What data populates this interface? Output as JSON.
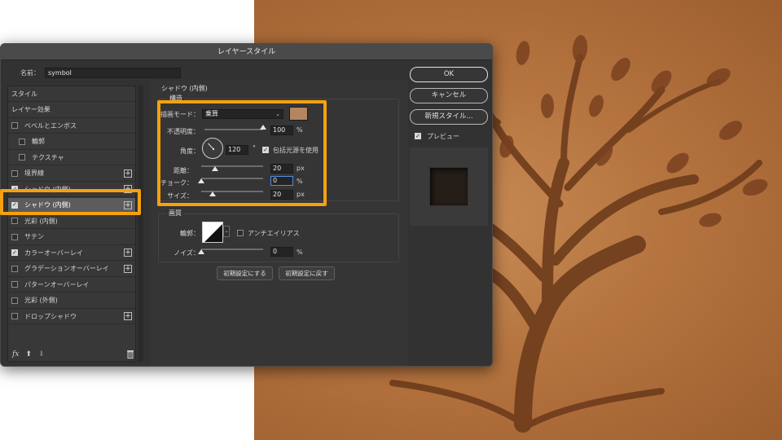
{
  "dialog": {
    "title": "レイヤースタイル",
    "name_label": "名前：",
    "name_value": "symbol"
  },
  "style_list": {
    "items": [
      {
        "label": "スタイル",
        "type": "header"
      },
      {
        "label": "レイヤー効果",
        "type": "header"
      },
      {
        "label": "ベベルとエンボス",
        "checked": false,
        "plus": false
      },
      {
        "label": "輪郭",
        "checked": false,
        "plus": false,
        "indent": true
      },
      {
        "label": "テクスチャ",
        "checked": false,
        "plus": false,
        "indent": true
      },
      {
        "label": "境界線",
        "checked": false,
        "plus": true
      },
      {
        "label": "シャドウ (内側)",
        "checked": true,
        "plus": true
      },
      {
        "label": "シャドウ (内側)",
        "checked": true,
        "plus": true,
        "selected": true
      },
      {
        "label": "光彩 (内側)",
        "checked": false,
        "plus": false
      },
      {
        "label": "サテン",
        "checked": false,
        "plus": false
      },
      {
        "label": "カラーオーバーレイ",
        "checked": true,
        "plus": true
      },
      {
        "label": "グラデーションオーバーレイ",
        "checked": false,
        "plus": true
      },
      {
        "label": "パターンオーバーレイ",
        "checked": false,
        "plus": false
      },
      {
        "label": "光彩 (外側)",
        "checked": false,
        "plus": false
      },
      {
        "label": "ドロップシャドウ",
        "checked": false,
        "plus": true
      }
    ],
    "footer": {
      "fx": "fx",
      "up": "⬆",
      "down": "⬇"
    }
  },
  "panel": {
    "section_title": "シャドウ (内側)",
    "structure_label": "構造",
    "blend_mode_label": "描画モード：",
    "blend_mode_value": "乗算",
    "opacity_label": "不透明度：",
    "opacity_value": "100",
    "opacity_fill": 1.0,
    "angle_label": "角度：",
    "angle_value": "120",
    "angle_unit": "°",
    "global_light_label": "包括光源を使用",
    "distance_label": "距離：",
    "distance_value": "20",
    "distance_fill": 0.08,
    "choke_label": "チョーク：",
    "choke_value": "0",
    "choke_fill": 0.0,
    "size_label": "サイズ：",
    "size_value": "20",
    "size_fill": 0.1,
    "unit_percent": "%",
    "unit_px": "px",
    "quality_label": "画質",
    "contour_label": "輪郭：",
    "anti_alias_label": "アンチエイリアス",
    "noise_label": "ノイズ：",
    "noise_value": "0",
    "noise_fill": 0.0,
    "reset_default_button": "初期設定にする",
    "restore_default_button": "初期設定に戻す"
  },
  "right": {
    "ok_button": "OK",
    "cancel_button": "キャンセル",
    "new_style_button": "新規スタイル...",
    "preview_label": "プレビュー",
    "preview_checked": true
  },
  "colors": {
    "shadow_color": "#b58560",
    "highlight": "#f5a10f",
    "leather": "#b6743f"
  }
}
